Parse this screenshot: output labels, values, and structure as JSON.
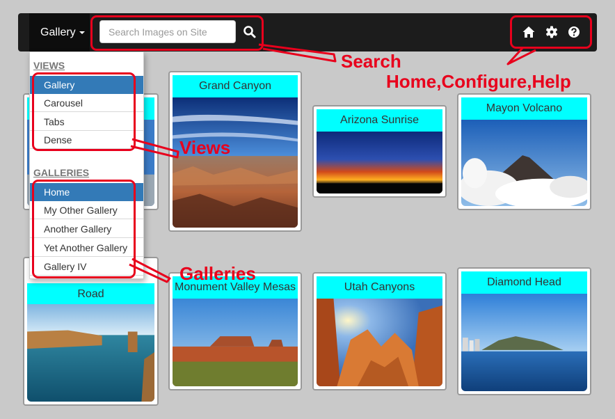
{
  "navbar": {
    "brand_label": "Gallery",
    "search_placeholder": "Search Images on Site"
  },
  "dropdown": {
    "views_header": "VIEWS",
    "views": [
      "Gallery",
      "Carousel",
      "Tabs",
      "Dense"
    ],
    "views_active": "Gallery",
    "galleries_header": "GALLERIES",
    "galleries": [
      "Home",
      "My Other Gallery",
      "Another Gallery",
      "Yet Another Gallery",
      "Gallery IV"
    ],
    "galleries_active": "Home"
  },
  "cards": [
    {
      "title": "Grand Canyon"
    },
    {
      "title": "Arizona Sunrise"
    },
    {
      "title": "Mayon Volcano"
    },
    {
      "title": "Road"
    },
    {
      "title": "Monument Valley Mesas"
    },
    {
      "title": "Utah Canyons"
    },
    {
      "title": "Diamond Head"
    }
  ],
  "annotations": {
    "search": "Search",
    "home_configure_help": "Home,Configure,Help",
    "views": "Views",
    "galleries": "Galleries"
  },
  "colors": {
    "accent": "#337ab7",
    "card_title_bg": "#00ffff",
    "annotation": "#e8001c"
  }
}
